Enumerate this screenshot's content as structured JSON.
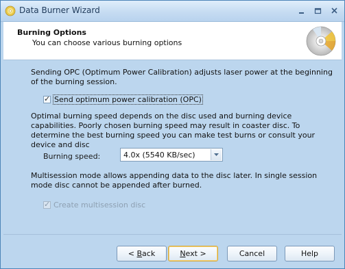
{
  "window": {
    "title": "Data Burner Wizard"
  },
  "header": {
    "title": "Burning Options",
    "subtitle": "You can choose various burning options"
  },
  "opc": {
    "description": "Sending OPC (Optimum Power Calibration) adjusts laser power at the beginning of the burning session.",
    "checkbox_label": "Send optimum power calibration (OPC)",
    "checked": true
  },
  "speed": {
    "description": "Optimal burning speed depends on the disc used and burning device capabilities. Poorly chosen burning speed may result in coaster disc. To determine the best burning speed you can make test burns or consult your device and disc",
    "label": "Burning speed:",
    "selected": "4.0x (5540 KB/sec)"
  },
  "multisession": {
    "description": "Multisession mode allows appending data to the disc later. In single session mode disc cannot be appended after burned.",
    "checkbox_label": "Create multisession disc",
    "checked": true,
    "disabled": true
  },
  "buttons": {
    "back": {
      "pre": "< ",
      "hot": "B",
      "post": "ack"
    },
    "next": {
      "pre": "",
      "hot": "N",
      "post": "ext >"
    },
    "cancel": "Cancel",
    "help": "Help"
  },
  "icons": {
    "title_icon": "disc-icon",
    "header_icon": "disc-burn-icon",
    "minimize": "minimize-icon",
    "maximize": "maximize-icon",
    "close": "close-icon",
    "dropdown": "chevron-down-icon",
    "check": "checkmark-icon"
  },
  "colors": {
    "dialog_bg": "#bcd6ee",
    "title_text": "#1f3a5a",
    "default_button_border": "#d8a93a"
  }
}
